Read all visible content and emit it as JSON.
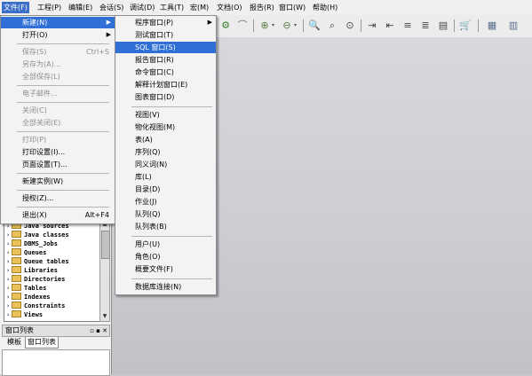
{
  "menubar": {
    "items": [
      "文件(F)",
      "工程(P)",
      "编辑(E)",
      "会话(S)",
      "调试(D)",
      "工具(T)",
      "宏(M)",
      "文档(O)",
      "报告(R)",
      "窗口(W)",
      "帮助(H)"
    ],
    "active_index": 0
  },
  "file_menu": {
    "items": [
      {
        "label": "新建(N)",
        "submenu": true,
        "highlighted": true
      },
      {
        "label": "打开(O)",
        "submenu": true
      },
      {
        "label": "保存(S)",
        "shortcut": "Ctrl+S",
        "disabled": true
      },
      {
        "label": "另存为(A)...",
        "disabled": true
      },
      {
        "label": "全部保存(L)",
        "disabled": true
      },
      {
        "label": "电子邮件...",
        "disabled": true
      },
      {
        "label": "关闭(C)",
        "disabled": true
      },
      {
        "label": "全部关闭(E)",
        "disabled": true
      },
      {
        "label": "打印(P)",
        "disabled": true
      },
      {
        "label": "打印设置(I)..."
      },
      {
        "label": "页面设置(T)..."
      },
      {
        "label": "新建实例(W)"
      },
      {
        "label": "授权(Z)..."
      },
      {
        "label": "退出(X)",
        "shortcut": "Alt+F4"
      }
    ]
  },
  "new_submenu": {
    "items": [
      {
        "label": "程序窗口(P)",
        "submenu": true
      },
      {
        "label": "测试窗口(T)"
      },
      {
        "label": "SQL 窗口(S)",
        "highlighted": true
      },
      {
        "label": "报告窗口(R)"
      },
      {
        "label": "命令窗口(C)"
      },
      {
        "label": "解释计划窗口(E)"
      },
      {
        "label": "图表窗口(D)"
      },
      {
        "label": "视图(V)"
      },
      {
        "label": "物化视图(M)"
      },
      {
        "label": "表(A)"
      },
      {
        "label": "序列(Q)"
      },
      {
        "label": "同义词(N)"
      },
      {
        "label": "库(L)"
      },
      {
        "label": "目录(D)"
      },
      {
        "label": "作业(J)"
      },
      {
        "label": "队列(Q)"
      },
      {
        "label": "队列表(B)"
      },
      {
        "label": "用户(U)"
      },
      {
        "label": "角色(O)"
      },
      {
        "label": "概要文件(F)"
      },
      {
        "label": "数据库连接(N)"
      }
    ]
  },
  "object_tree": {
    "items": [
      "Java sources",
      "Java classes",
      "DBMS_Jobs",
      "Queues",
      "Queue tables",
      "Libraries",
      "Directories",
      "Tables",
      "Indexes",
      "Constraints",
      "Views"
    ]
  },
  "window_list": {
    "title": "窗口列表",
    "tabs": [
      "模板",
      "窗口列表"
    ],
    "selected_tab": 1
  },
  "colors": {
    "highlight": "#2f6fd6",
    "menu_bg": "#f3f3f3",
    "workspace": "#cfcdd3"
  }
}
